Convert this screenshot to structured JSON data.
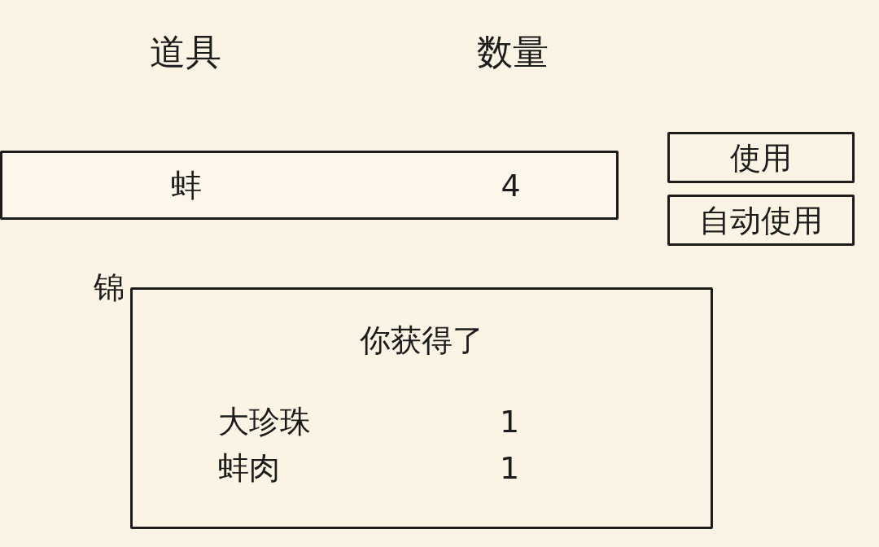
{
  "columns": [
    "道具",
    "数量"
  ],
  "items": [
    {
      "name": "蚌",
      "count": "4",
      "selected": true
    },
    {
      "name": "锦",
      "selected": false
    }
  ],
  "actions": [
    "使用",
    "自动使用"
  ],
  "dialog": {
    "title": "你获得了",
    "rewards": [
      {
        "name": "大珍珠",
        "count": "1"
      },
      {
        "name": "蚌肉",
        "count": "1"
      }
    ]
  }
}
